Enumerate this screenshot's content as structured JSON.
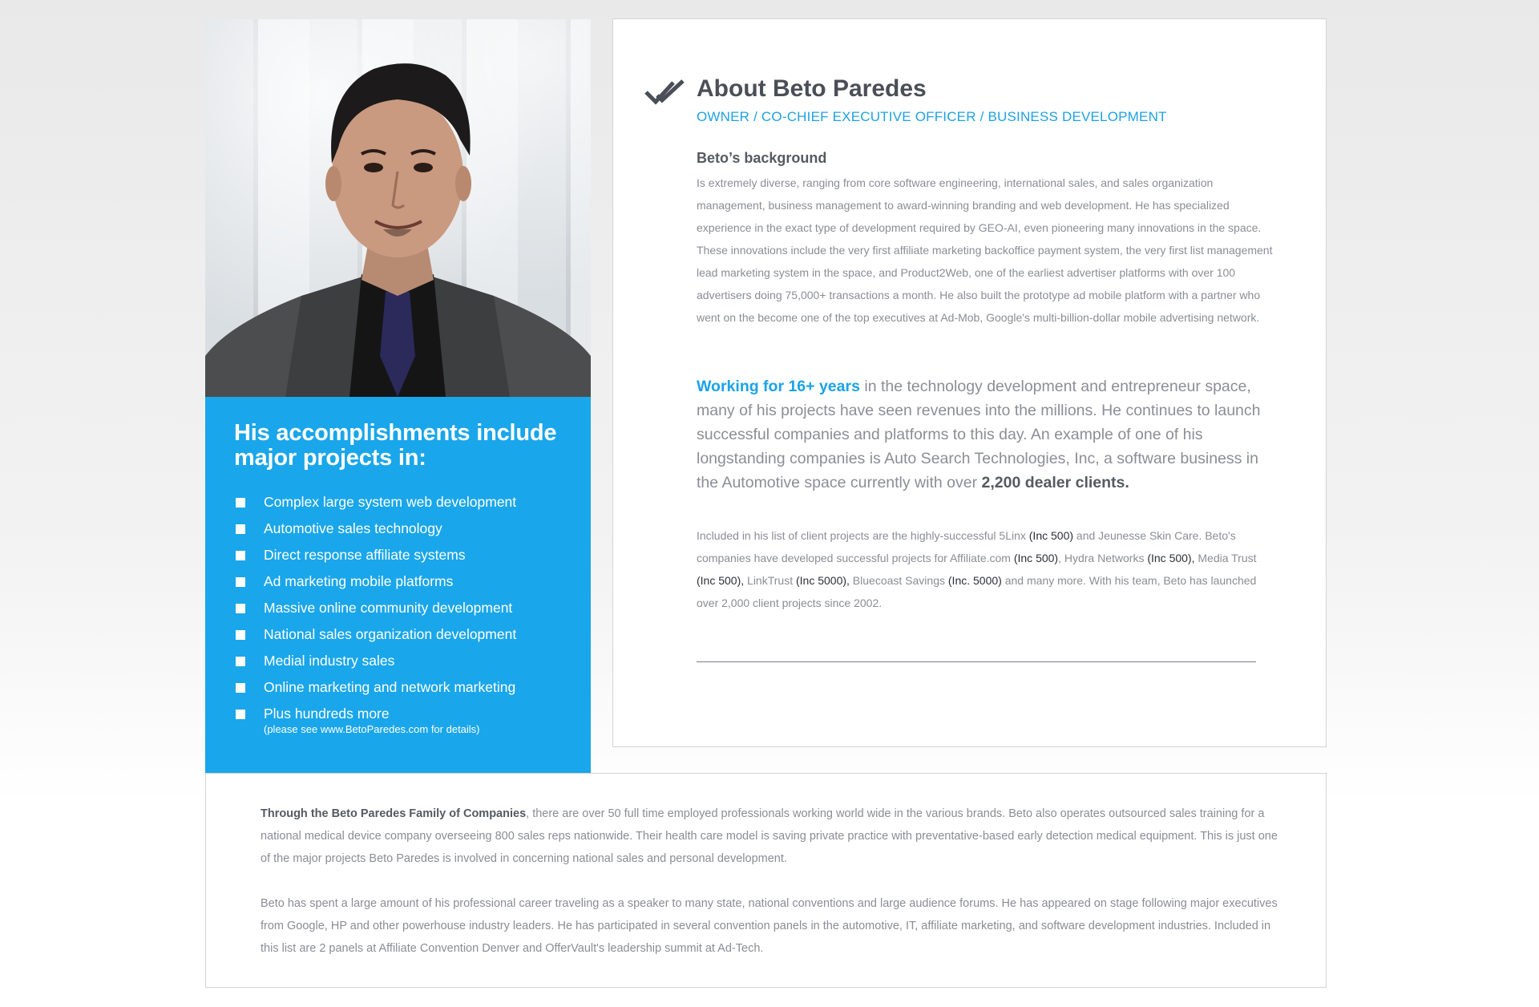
{
  "accomplishments": {
    "title": "His accomplishments include major projects in:",
    "items": [
      {
        "label": "Complex large system web development"
      },
      {
        "label": "Automotive sales technology"
      },
      {
        "label": "Direct response affiliate systems"
      },
      {
        "label": "Ad marketing mobile platforms"
      },
      {
        "label": "Massive online community development"
      },
      {
        "label": "National sales organization development"
      },
      {
        "label": "Medial industry sales"
      },
      {
        "label": "Online marketing and network marketing"
      },
      {
        "label": "Plus hundreds more",
        "note": "(please see www.BetoParedes.com for details)"
      }
    ]
  },
  "about": {
    "title": "About Beto Paredes",
    "subtitle": "OWNER / CO-CHIEF EXECUTIVE OFFICER / BUSINESS DEVELOPMENT",
    "background_heading": "Beto’s background",
    "background_text": "Is extremely diverse, ranging from core software engineering, international sales, and sales organization management, business management to award-winning branding and web development. He has specialized experience in the exact type of development required by GEO-AI, even pioneering many innovations in the space. These innovations include the very first affiliate marketing backoffice payment system, the very first list management lead marketing system in the space, and Product2Web, one of the earliest advertiser platforms with over 100 advertisers doing 75,000+ transactions a month. He also built the prototype ad mobile platform with a partner who went on the become one of the top executives at Ad-Mob, Google's multi-billion-dollar mobile advertising network.",
    "working": {
      "highlight": "Working for 16+ years",
      "text": " in the technology development and entrepreneur space, many of his projects have seen revenues into the millions. He continues to launch successful companies and platforms to this day. An example of one of his longstanding companies is Auto Search Technologies, Inc, a software business in the Automotive space currently with over ",
      "emphasis": "2,200 dealer clients."
    },
    "clients": [
      {
        "t": "Included in his list of client projects are the highly-successful 5Linx ",
        "s": "lt"
      },
      {
        "t": "(Inc 500)",
        "s": "dk"
      },
      {
        "t": " and Jeunesse Skin Care. Beto's companies have developed successful projects for Affiliate.com ",
        "s": "lt"
      },
      {
        "t": "(Inc 500)",
        "s": "dk"
      },
      {
        "t": ", Hydra Networks ",
        "s": "lt"
      },
      {
        "t": "(Inc 500),",
        "s": "dk"
      },
      {
        "t": " Media Trust ",
        "s": "lt"
      },
      {
        "t": "(Inc 500),",
        "s": "dk"
      },
      {
        "t": " LinkTrust ",
        "s": "lt"
      },
      {
        "t": "(Inc 5000),",
        "s": "dk"
      },
      {
        "t": " Bluecoast Savings ",
        "s": "lt"
      },
      {
        "t": "(Inc. 5000)",
        "s": "dk"
      },
      {
        "t": " and many more. With his team, Beto has launched over 2,000 client projects since 2002.",
        "s": "lt"
      }
    ]
  },
  "bottom": {
    "p1_bold": "Through the Beto Paredes Family of Companies",
    "p1_text": ", there are over 50 full time employed professionals working world wide in the various brands. Beto also operates outsourced sales training for a national medical device company overseeing 800 sales reps nationwide. Their health care model is saving private practice with preventative-based early detection medical equipment. This is just one of the major projects Beto Paredes is involved in concerning national sales and personal development.",
    "p2": "Beto has spent a large amount of his professional career traveling as a speaker to many state, national conventions and large audience forums. He has appeared on stage following major executives from Google, HP and other powerhouse industry leaders. He has participated in several convention panels in the automotive, IT, affiliate marketing, and software development industries. Included in this list are 2 panels at Affiliate Convention Denver and OfferVault's leadership summit at Ad-Tech."
  },
  "colors": {
    "accent": "#1aa6ea",
    "heading": "#4a4e57",
    "body_text": "#8a8d93"
  },
  "icons": {
    "title_icon": "double-check-icon",
    "bullet": "square-bullet-icon",
    "portrait": "portrait-photo"
  }
}
